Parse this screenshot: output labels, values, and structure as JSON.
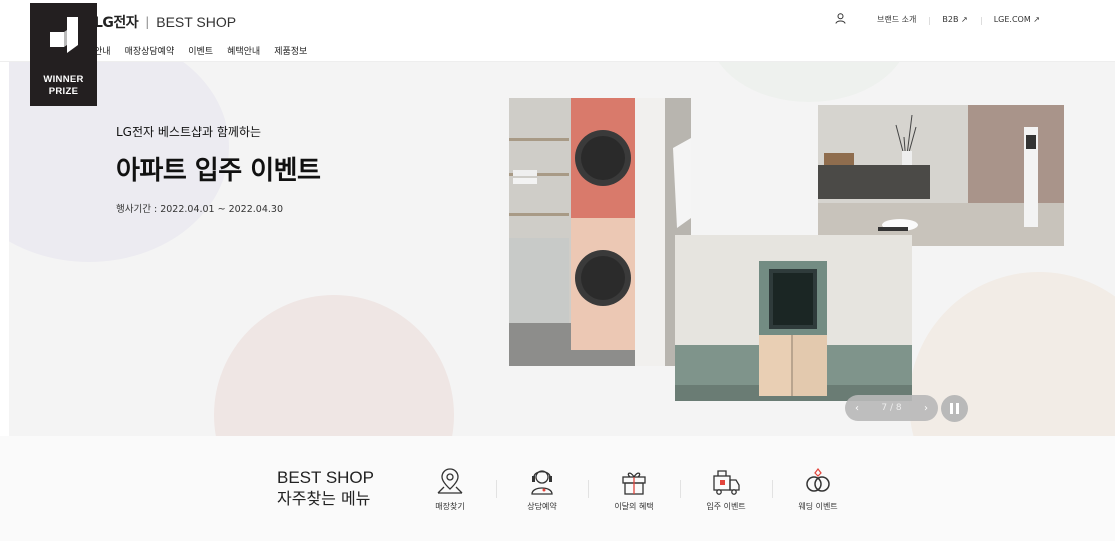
{
  "badge": {
    "line1": "WINNER",
    "line2": "PRIZE"
  },
  "header": {
    "brand_lg": "LG전자",
    "brand_sep": "|",
    "brand_shop": "BEST SHOP",
    "nav": [
      "안내",
      "매장상담예약",
      "이벤트",
      "혜택안내",
      "제품정보"
    ],
    "util": {
      "brand_intro": "브랜드 소개",
      "b2b": "B2B ↗",
      "lgecom": "LGE.COM ↗"
    }
  },
  "hero": {
    "subtitle": "LG전자 베스트샵과 함께하는",
    "title": "아파트 입주 이벤트",
    "date": "행사기간 : 2022.04.01 ~ 2022.04.30",
    "pager": "7 / 8",
    "prev": "‹",
    "next": "›"
  },
  "quick": {
    "title_en": "BEST SHOP",
    "title_ko": "자주찾는 메뉴",
    "items": [
      {
        "label": "매장찾기",
        "icon": "map-pin-icon"
      },
      {
        "label": "상담예약",
        "icon": "consultant-icon"
      },
      {
        "label": "이달의 혜택",
        "icon": "gift-icon"
      },
      {
        "label": "입주 이벤트",
        "icon": "moving-truck-icon"
      },
      {
        "label": "웨딩 이벤트",
        "icon": "wedding-rings-icon"
      }
    ]
  },
  "colors": {
    "hero_bg": "#f4f4f4",
    "badge_bg": "#231f20",
    "washer_orange": "#e0776a",
    "washer_beige": "#ecc9b7",
    "fridge_green": "#6f8a7f"
  }
}
